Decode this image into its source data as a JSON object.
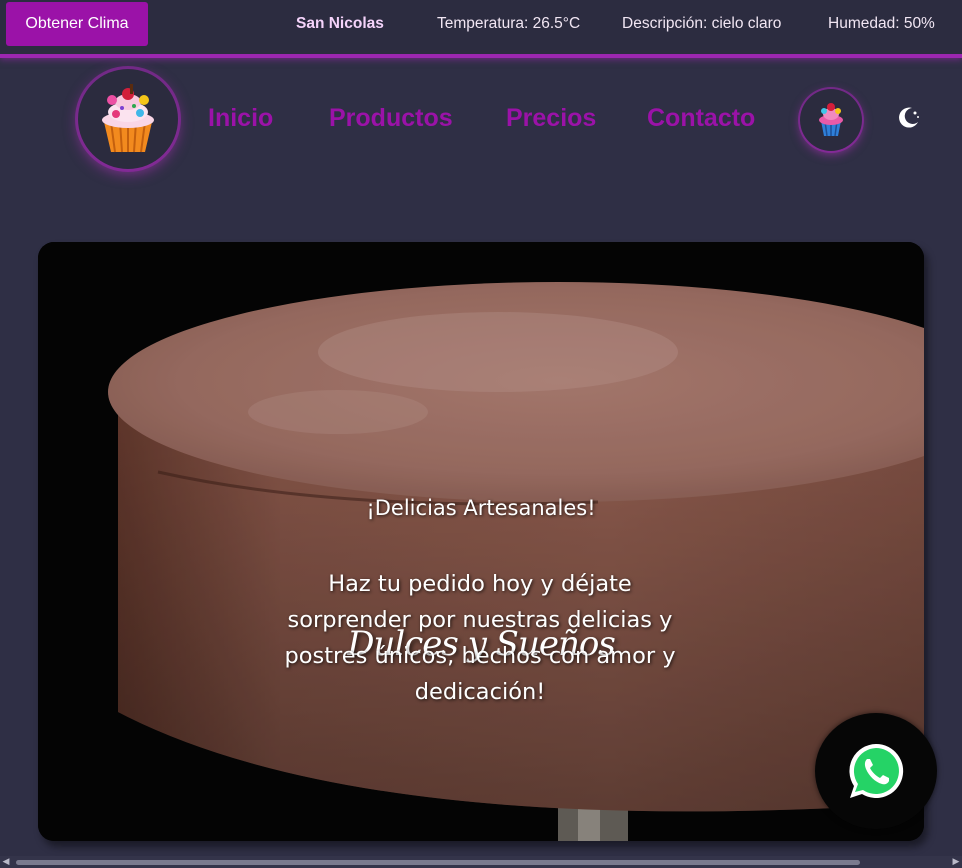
{
  "weather": {
    "button_label": "Obtener Clima",
    "city": "San Nicolas",
    "temperature": "Temperatura: 26.5°C",
    "description": "Descripción: cielo claro",
    "humidity": "Humedad: 50%"
  },
  "nav": {
    "logo_icon": "cupcake-logo",
    "links": [
      "Inicio",
      "Productos",
      "Precios",
      "Contacto"
    ],
    "secondary_logo_icon": "cupcake-icon",
    "theme_toggle_icon": "moon-star-icon"
  },
  "hero": {
    "title": "Dulces y Sueños",
    "subtitle": "¡Delicias Artesanales!",
    "description": "Haz tu pedido hoy y déjate sorprender por nuestras delicias y postres únicos, hechos con amor y dedicación!",
    "background_image": "chocolate-cake-photo"
  },
  "floating": {
    "whatsapp_icon": "whatsapp-icon"
  },
  "colors": {
    "accent": "#9b12a8",
    "background": "#2f2f45",
    "topbar": "#2c2c40",
    "whatsapp_green": "#25d366"
  }
}
